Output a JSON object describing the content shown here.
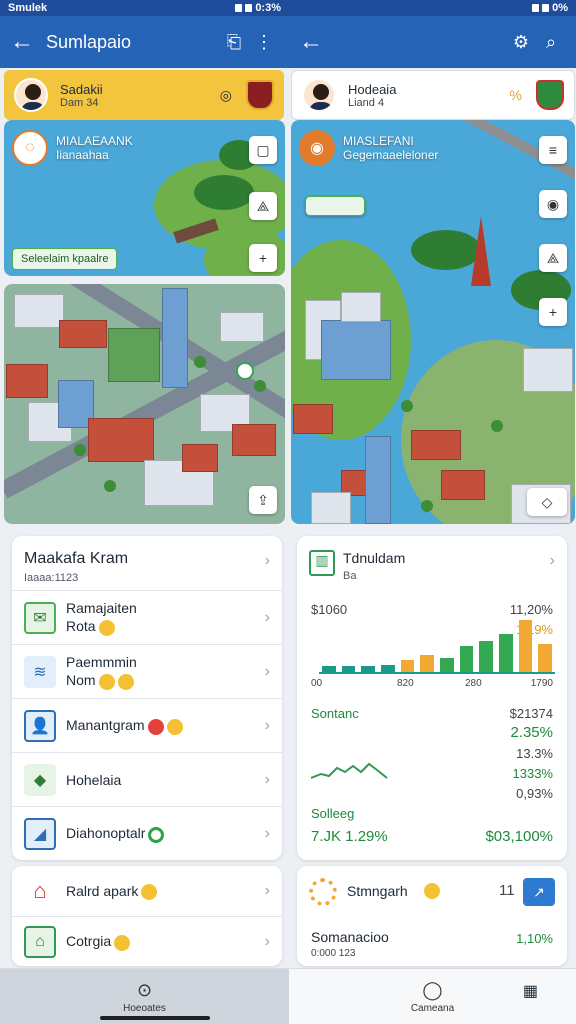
{
  "left": {
    "status": {
      "carrier": "Smulek",
      "battery": "0:3%"
    },
    "appbar": {
      "back_icon": "←",
      "title": "Sumlapaio",
      "action1_icon": "⎗",
      "menu_icon": "⋮"
    },
    "banner": {
      "name": "Sadakii",
      "sub": "Dam 34",
      "icon": "◎"
    },
    "map": {
      "title_line1": "MIALAEAANK",
      "title_line2": "Iianaahaa",
      "chip": "Seleelaim kpaalre",
      "btn1": "▢",
      "btn2": "⟁",
      "btn3": "+"
    },
    "city": {
      "btn": "⇪"
    },
    "list": {
      "title": "Maakafa Kram",
      "sub": "Iaaaa:1123",
      "items": [
        {
          "line1": "Ramajaiten",
          "line2": "Rota"
        },
        {
          "line1": "Paemmmin",
          "line2": "Nom"
        },
        {
          "line1": "Manantgram",
          "line2": ""
        },
        {
          "line1": "Hohelaia",
          "line2": ""
        },
        {
          "line1": "Diahonoptalr",
          "line2": ""
        }
      ]
    },
    "list2": {
      "items": [
        {
          "label": "Ralrd apark"
        },
        {
          "label": "Cotrgia"
        }
      ]
    },
    "nav": {
      "icon": "⊙",
      "label": "Hoeoates"
    }
  },
  "right": {
    "status": {
      "battery": "0%"
    },
    "appbar": {
      "back_icon": "←",
      "gear_icon": "⚙",
      "search_icon": "⌕"
    },
    "banner": {
      "name": "Hodeaia",
      "sub": "Liand 4",
      "badge": "%"
    },
    "map": {
      "title_line1": "MIASLEFANI",
      "title_line2": "Gegemaaeleloner",
      "btn1": "≡",
      "btn2": "◉",
      "btn3": "⟁",
      "btn4": "+"
    },
    "stats": {
      "title": "Tdnuldam",
      "sub": "Ba",
      "y_left": "$1060",
      "y_right1": "11,20%",
      "y_right2": "1 19%",
      "x_labels": [
        "00",
        "820",
        "280",
        "1790"
      ],
      "sec1_title": "Sontanc",
      "sec1_values": [
        "$21374",
        "2.35%",
        "13.3%",
        "1333%",
        "0,93%"
      ],
      "sec2_title": "Solleeg",
      "sec2_left": "7.JK 1.29%",
      "sec2_right": "$03,100%"
    },
    "chart_data": {
      "type": "bar",
      "categories": [
        "1",
        "2",
        "3",
        "4",
        "5",
        "6",
        "7",
        "8",
        "9",
        "10",
        "11",
        "12"
      ],
      "values": [
        5,
        5,
        5,
        6,
        10,
        14,
        12,
        22,
        26,
        32,
        44,
        24
      ],
      "colors": [
        "#1b9a8a",
        "#1b9a8a",
        "#1b9a8a",
        "#1b9a8a",
        "#f2a933",
        "#f2a933",
        "#35a853",
        "#35a853",
        "#35a853",
        "#35a853",
        "#f2a933",
        "#f2a933"
      ]
    },
    "stats2": {
      "title": "Stmngarh",
      "count": "11",
      "line": "Somanacioo",
      "sub": "0:000 123",
      "pct": "1,10%"
    },
    "nav": {
      "icon": "◯",
      "label": "Cameana",
      "icon2": "▦"
    }
  }
}
